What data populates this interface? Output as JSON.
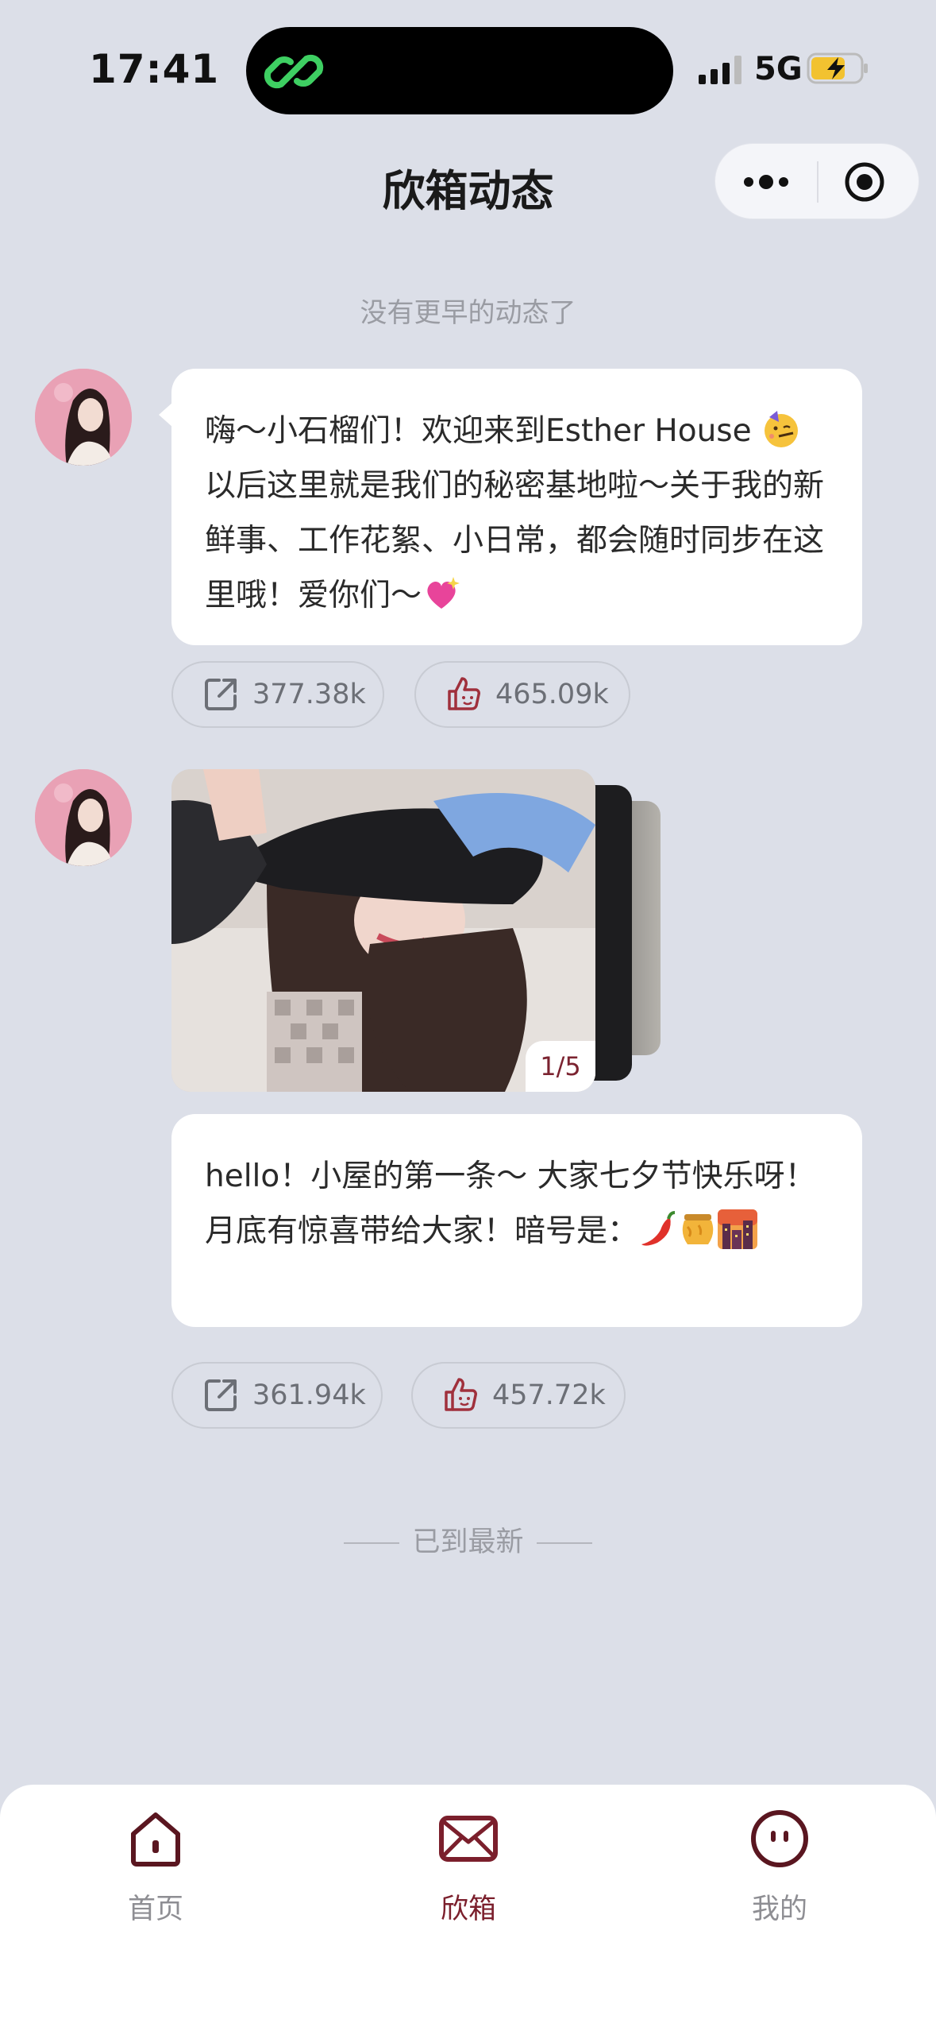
{
  "status_bar": {
    "time": "17:41",
    "network": "5G"
  },
  "nav": {
    "title": "欣箱动态"
  },
  "feed": {
    "top_hint": "没有更早的动态了",
    "end_hint": "已到最新",
    "posts": [
      {
        "text_parts": [
          "嗨～小石榴们！欢迎来到Esther House ",
          " 以后这里就是我们的秘密基地啦～关于我的新鲜事、工作花絮、小日常，都会随时同步在这里哦！爱你们～"
        ],
        "emojis": [
          "partying-face",
          "sparkling-heart"
        ],
        "shares": "377.38k",
        "likes": "465.09k"
      },
      {
        "photo_counter": "1/5",
        "text": "hello！小屋的第一条～ 大家七夕节快乐呀！月底有惊喜带给大家！暗号是：",
        "emojis": [
          "hot-pepper",
          "honey-pot",
          "city-sunset"
        ],
        "shares": "361.94k",
        "likes": "457.72k"
      }
    ]
  },
  "tabbar": {
    "items": [
      {
        "label": "首页",
        "icon": "home-icon"
      },
      {
        "label": "欣箱",
        "icon": "mail-icon",
        "active": true
      },
      {
        "label": "我的",
        "icon": "face-icon"
      }
    ]
  },
  "colors": {
    "background": "#dcdfe8",
    "accent": "#7b1f2c",
    "island_icon": "#3ecf62"
  }
}
